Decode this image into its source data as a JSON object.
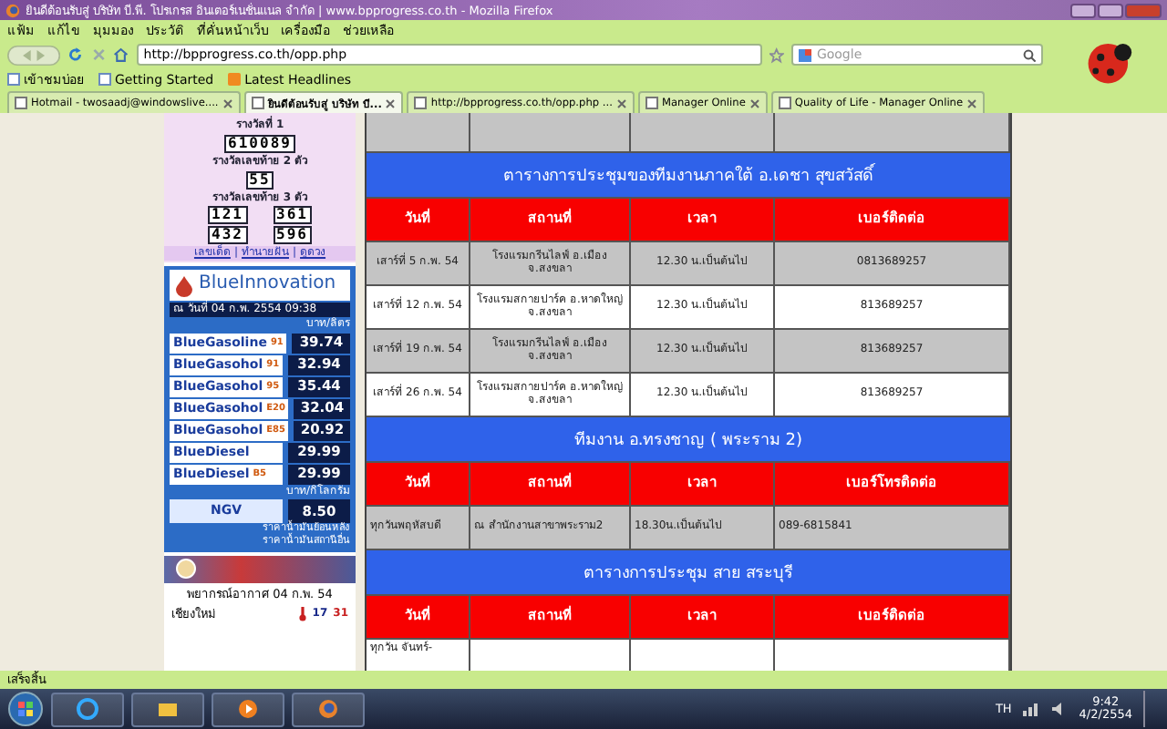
{
  "window": {
    "title": "ยินดีต้อนรับสู่ บริษัท บี.พี. โปรเกรส อินเตอร์เนชั่นแนล จำกัด | www.bpprogress.co.th - Mozilla Firefox"
  },
  "menu": [
    "แฟ้ม",
    "แก้ไข",
    "มุมมอง",
    "ประวัติ",
    "ที่คั่นหน้าเว็บ",
    "เครื่องมือ",
    "ช่วยเหลือ"
  ],
  "address_bar": {
    "value": "http://bpprogress.co.th/opp.php"
  },
  "search": {
    "placeholder": "Google"
  },
  "bookmarks": [
    "เข้าชมบ่อย",
    "Getting Started",
    "Latest Headlines"
  ],
  "tabs": [
    {
      "label": "Hotmail - twosaadj@windowslive....",
      "selected": false
    },
    {
      "label": "ยินดีต้อนรับสู่ บริษัท บี...",
      "selected": true
    },
    {
      "label": "http://bpprogress.co.th/opp.php ...",
      "selected": false
    },
    {
      "label": "Manager Online",
      "selected": false
    },
    {
      "label": "Quality of Life - Manager Online",
      "selected": false
    }
  ],
  "lottery": {
    "first_prize_label": "รางวัลที่ 1",
    "first_prize": "610089",
    "two_digit_label": "รางวัลเลขท้าย 2 ตัว",
    "two_digit": "55",
    "three_digit_label": "รางวัลเลขท้าย 3 ตัว",
    "three_digit": [
      "121",
      "361",
      "432",
      "596"
    ],
    "links": [
      "เลขเด็ด",
      "ทำนายฝัน",
      "ดูดวง"
    ],
    "link_separator": "|"
  },
  "oil_prices": {
    "brand": "BlueInnovation",
    "date": "ณ วันที่ 04 ก.พ. 2554 09:38",
    "unit": "บาท/ลิตร",
    "fuels": [
      {
        "name": "BlueGasoline",
        "grade": "91",
        "price": "39.74"
      },
      {
        "name": "BlueGasohol",
        "grade": "91",
        "price": "32.94"
      },
      {
        "name": "BlueGasohol",
        "grade": "95",
        "price": "35.44"
      },
      {
        "name": "BlueGasohol",
        "grade": "E20",
        "price": "32.04"
      },
      {
        "name": "BlueGasohol",
        "grade": "E85",
        "price": "20.92"
      },
      {
        "name": "BlueDiesel",
        "price": "29.99"
      },
      {
        "name": "BlueDiesel",
        "grade": "B5",
        "price": "29.99"
      }
    ],
    "gas_unit": "บาท/กิโลกรัม",
    "gas": {
      "name": "NGV",
      "price": "8.50"
    },
    "links": [
      "ราคาน้ำมันย้อนหลัง",
      "ราคาน้ำมันสถานีอื่น"
    ]
  },
  "weather": {
    "forecast": "พยากรณ์อากาศ 04 ก.พ. 54",
    "city": "เชียงใหม่",
    "low": "17",
    "high": "31"
  },
  "sections": [
    {
      "title": "ตารางการประชุมของทีมงานภาคใต้ อ.เดชา  สุขสวัสดิ์",
      "columns": [
        "วันที่",
        "สถานที่",
        "เวลา",
        "เบอร์ติดต่อ"
      ],
      "rows": [
        {
          "shaded": true,
          "cells": [
            "เสาร์ที่ 5  ก.พ. 54",
            "โรงแรมกรีนไลฟ์ อ.เมือง จ.สงขลา",
            "12.30 น.เป็นต้นไป",
            "0813689257"
          ]
        },
        {
          "shaded": false,
          "cells": [
            "เสาร์ที่ 12 ก.พ. 54",
            "โรงแรมสกายปาร์ค อ.หาดใหญ่ จ.สงขลา",
            "12.30 น.เป็นต้นไป",
            "813689257"
          ]
        },
        {
          "shaded": true,
          "cells": [
            "เสาร์ที่ 19 ก.พ. 54",
            "โรงแรมกรีนไลฟ์ อ.เมือง จ.สงขลา",
            "12.30 น.เป็นต้นไป",
            "813689257"
          ]
        },
        {
          "shaded": false,
          "cells": [
            "เสาร์ที่ 26 ก.พ. 54",
            "โรงแรมสกายปาร์ค อ.หาดใหญ่ จ.สงขลา",
            "12.30 น.เป็นต้นไป",
            "813689257"
          ]
        }
      ]
    },
    {
      "title": "ทีมงาน อ.ทรงชาญ ( พระราม 2)",
      "columns": [
        "วันที่",
        "สถานที่",
        "เวลา",
        "เบอร์โทรติดต่อ"
      ],
      "rows": [
        {
          "shaded": true,
          "cells": [
            "ทุกวันพฤหัสบดี",
            "ณ สำนักงานสาขาพระราม2",
            "18.30น.เป็นต้นไป",
            "089-6815841"
          ]
        }
      ]
    },
    {
      "title": "ตารางการประชุม สาย สระบุรี",
      "columns": [
        "วันที่",
        "สถานที่",
        "เวลา",
        "เบอร์ติดต่อ"
      ],
      "rows": [
        {
          "shaded": false,
          "cells": [
            "ทุกวัน จันทร์-"
          ]
        }
      ]
    }
  ],
  "status_bar": "เสร็จสิ้น",
  "taskbar": {
    "language": "TH",
    "time": "9:42",
    "date": "4/2/2554"
  }
}
